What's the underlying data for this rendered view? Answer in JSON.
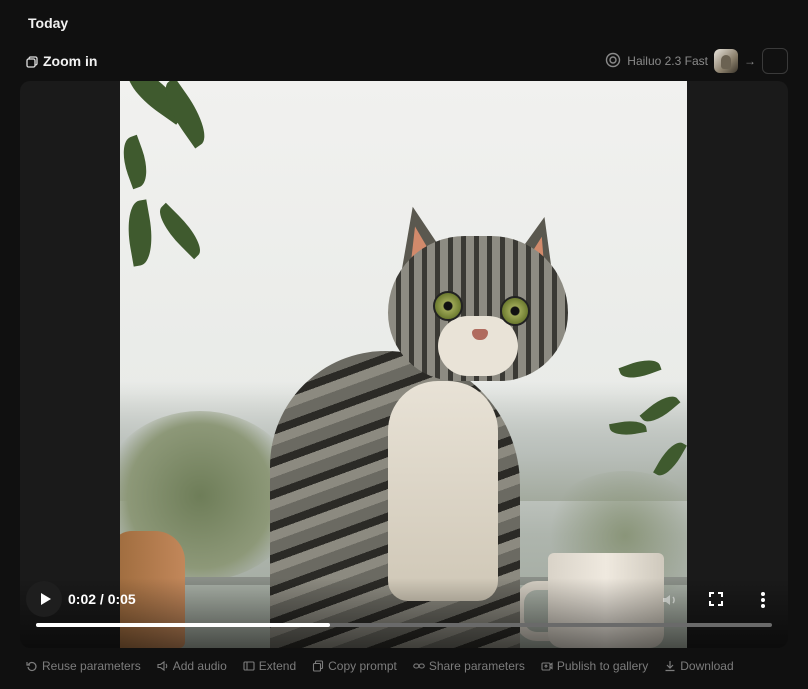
{
  "section": {
    "title": "Today"
  },
  "task": {
    "mode_label": "Zoom in",
    "model_name": "Hailuo 2.3 Fast"
  },
  "player": {
    "current_time": "0:02",
    "duration": "0:05",
    "time_display": "0:02 / 0:05",
    "progress_fraction": 0.4
  },
  "actions": [
    {
      "label": "Reuse parameters",
      "icon": "reuse-icon"
    },
    {
      "label": "Add audio",
      "icon": "audio-icon"
    },
    {
      "label": "Extend",
      "icon": "extend-icon"
    },
    {
      "label": "Copy prompt",
      "icon": "copy-icon"
    },
    {
      "label": "Share parameters",
      "icon": "link-icon"
    },
    {
      "label": "Publish to gallery",
      "icon": "publish-icon"
    },
    {
      "label": "Download",
      "icon": "download-icon"
    }
  ],
  "colors": {
    "background": "#101010",
    "muted_text": "#7c7c7c",
    "progress_fill": "#ffffff"
  }
}
